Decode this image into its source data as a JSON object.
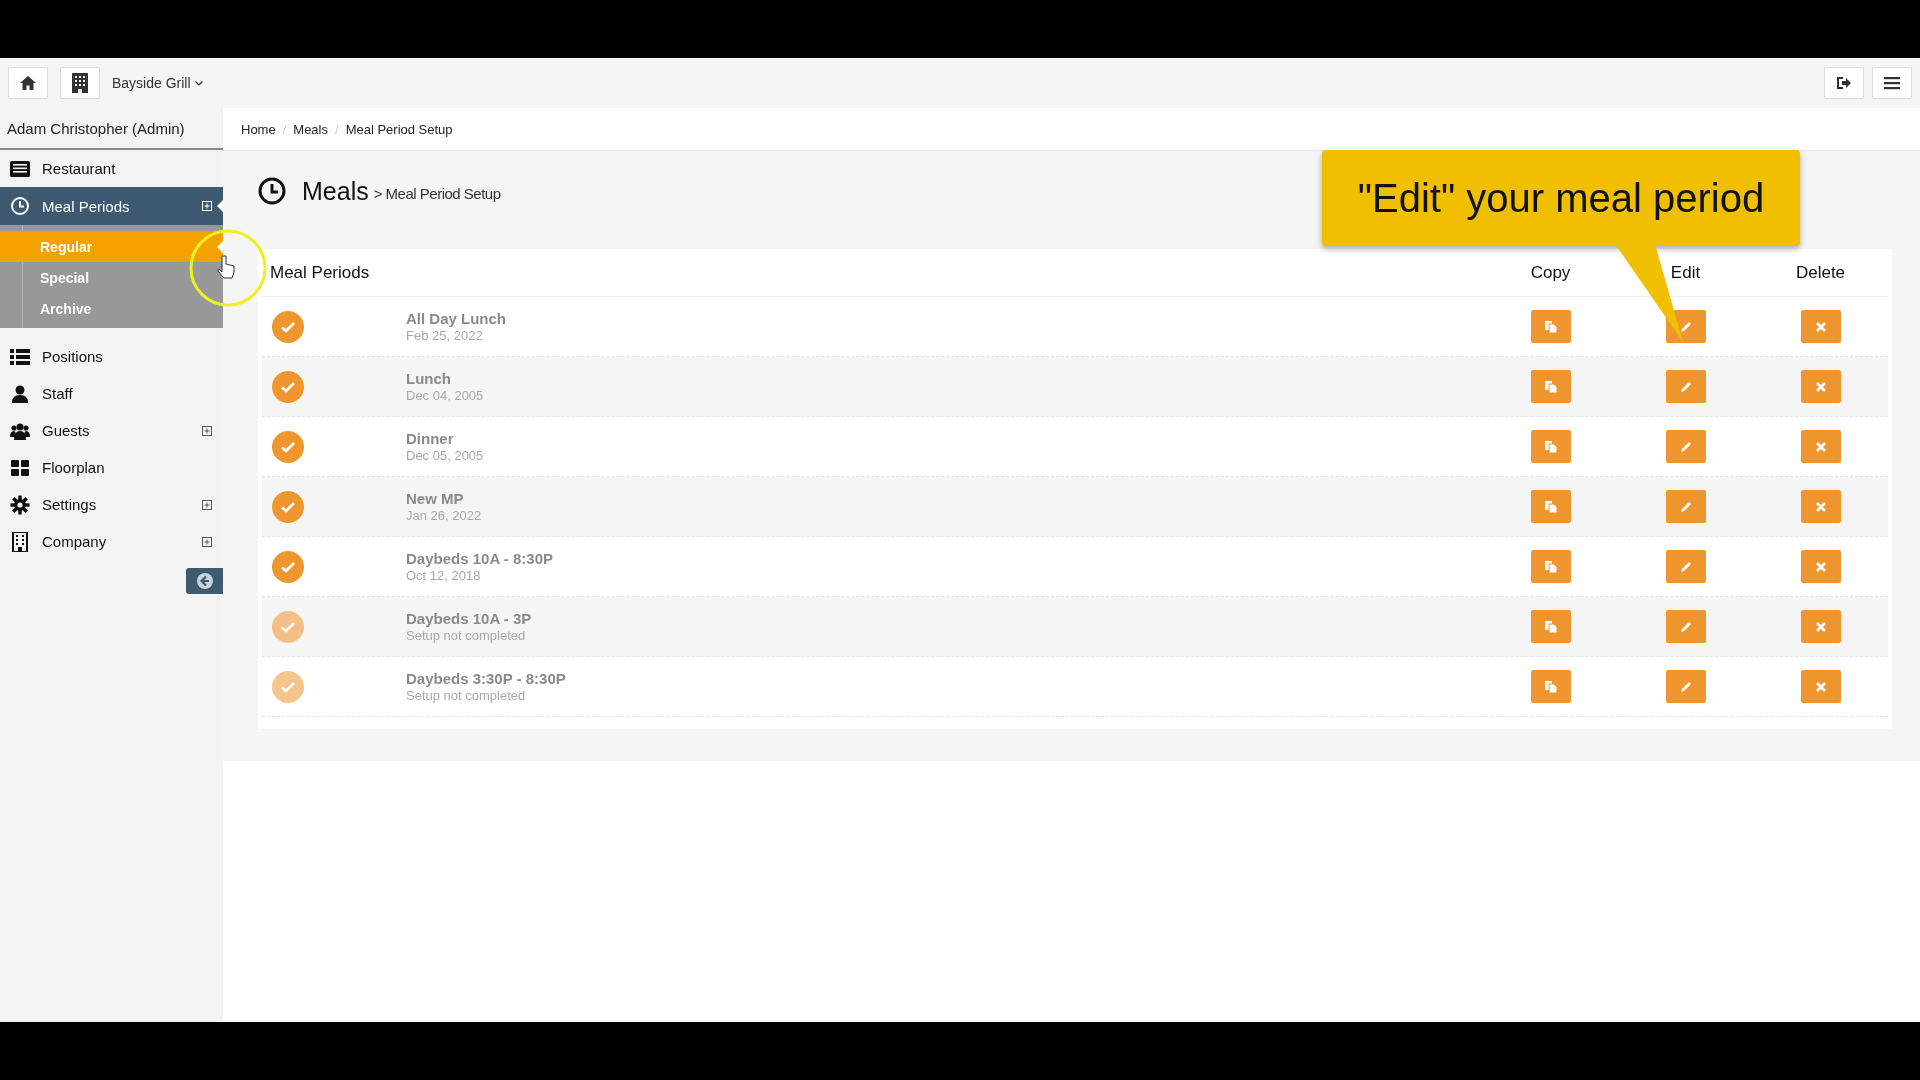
{
  "topbar": {
    "venue": "Bayside Grill"
  },
  "sidebar": {
    "user": "Adam Christopher (Admin)",
    "items": [
      {
        "label": "Restaurant",
        "selected": false,
        "expandable": false
      },
      {
        "label": "Meal Periods",
        "selected": true,
        "expandable": true,
        "children": [
          {
            "label": "Regular",
            "selected": true
          },
          {
            "label": "Special",
            "selected": false
          },
          {
            "label": "Archive",
            "selected": false
          }
        ]
      },
      {
        "label": "Positions",
        "selected": false,
        "expandable": false
      },
      {
        "label": "Staff",
        "selected": false,
        "expandable": false
      },
      {
        "label": "Guests",
        "selected": false,
        "expandable": true
      },
      {
        "label": "Floorplan",
        "selected": false,
        "expandable": false
      },
      {
        "label": "Settings",
        "selected": false,
        "expandable": true
      },
      {
        "label": "Company",
        "selected": false,
        "expandable": true
      }
    ]
  },
  "breadcrumb": {
    "separator": "/",
    "items": [
      "Home",
      "Meals",
      "Meal Period Setup"
    ]
  },
  "page": {
    "title": "Meals",
    "subtitle": "> Meal Period Setup"
  },
  "callout": "\"Edit\" your meal period",
  "table": {
    "columns": [
      "Meal Periods",
      "Copy",
      "Edit",
      "Delete"
    ],
    "rows": [
      {
        "name": "All Day Lunch",
        "detail": "Feb 25, 2022",
        "completed": true
      },
      {
        "name": "Lunch",
        "detail": "Dec 04, 2005",
        "completed": true
      },
      {
        "name": "Dinner",
        "detail": "Dec 05, 2005",
        "completed": true
      },
      {
        "name": "New MP",
        "detail": "Jan 26, 2022",
        "completed": true
      },
      {
        "name": "Daybeds 10A - 8:30P",
        "detail": "Oct 12, 2018",
        "completed": true
      },
      {
        "name": "Daybeds 10A - 3P",
        "detail": "Setup not completed",
        "completed": false
      },
      {
        "name": "Daybeds 3:30P - 8:30P",
        "detail": "Setup not completed",
        "completed": false
      }
    ]
  }
}
